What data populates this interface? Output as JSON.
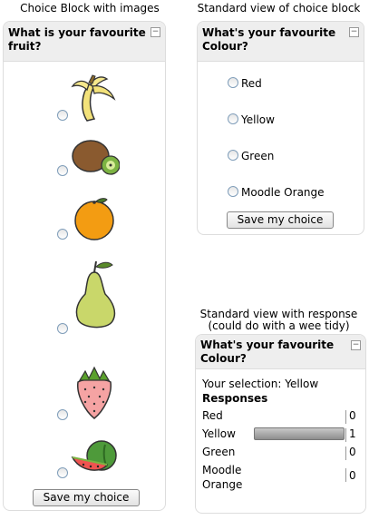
{
  "captions": {
    "images": "Choice Block with images",
    "standard": "Standard view of choice block",
    "response_line1": "Standard view with response",
    "response_line2": "(could do with a wee tidy)"
  },
  "fruit_block": {
    "title": "What is your favourite fruit?",
    "options": [
      {
        "icon": "banana-icon"
      },
      {
        "icon": "kiwi-icon"
      },
      {
        "icon": "orange-icon"
      },
      {
        "icon": "pear-icon"
      },
      {
        "icon": "strawberry-icon"
      },
      {
        "icon": "watermelon-icon"
      }
    ],
    "save_label": "Save my choice"
  },
  "colour_block": {
    "title": "What's your favourite Colour?",
    "options": [
      "Red",
      "Yellow",
      "Green",
      "Moodle Orange"
    ],
    "save_label": "Save my choice"
  },
  "response_block": {
    "title": "What's your favourite Colour?",
    "selection": "Your selection: Yellow",
    "responses_heading": "Responses",
    "rows": [
      {
        "label": "Red",
        "count": "0",
        "fraction": 0
      },
      {
        "label": "Yellow",
        "count": "1",
        "fraction": 1
      },
      {
        "label": "Green",
        "count": "0",
        "fraction": 0
      },
      {
        "label": "Moodle Orange",
        "count": "0",
        "fraction": 0
      }
    ]
  },
  "collapse_glyph": "−",
  "colors": {
    "header_bg": "#eeeeee",
    "border": "#dddddd",
    "bar": "#999999"
  }
}
